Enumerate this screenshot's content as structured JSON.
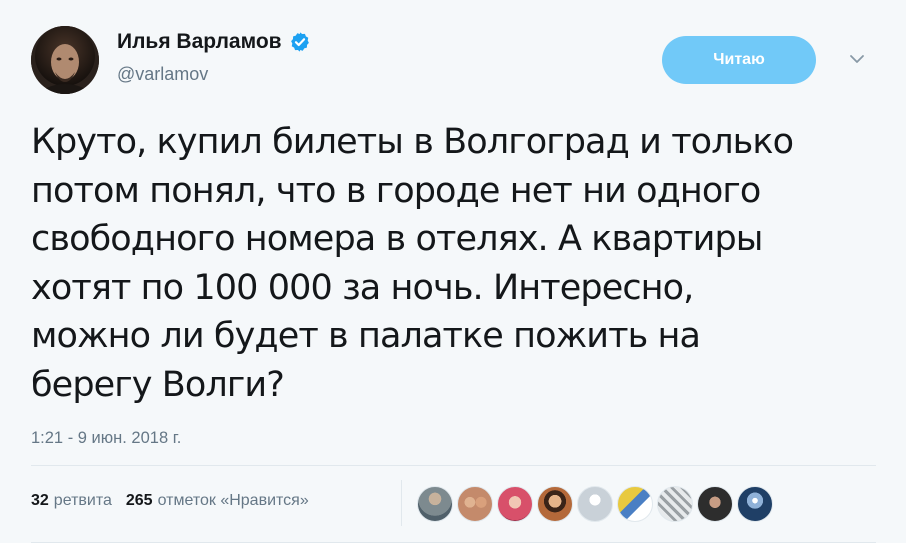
{
  "author": {
    "display_name": "Илья Варламов",
    "handle": "@varlamov",
    "verified_icon": "verified-badge-icon",
    "avatar_icon": "user-avatar"
  },
  "follow_button": {
    "label": "Читаю",
    "color": "#71c9f8"
  },
  "menu_caret_icon": "chevron-down-icon",
  "tweet": {
    "text": "Круто, купил билеты в Волгоград и только\nпотом понял, что в городе нет ни одного\nсвободного номера в отелях. А квартиры\nхотят по 100 000 за ночь. Интересно,\nможно ли будет в палатке пожить на\nберегу Волги?",
    "timestamp": "1:21 - 9 июн. 2018 г."
  },
  "stats": {
    "retweets_count": "32",
    "retweets_label": "ретвита",
    "likes_count": "265",
    "likes_label": "отметок «Нравится»"
  },
  "likers": [
    {
      "name": "liker-avatar-1",
      "color": "#7d8a8f"
    },
    {
      "name": "liker-avatar-2",
      "color": "#c48a6b"
    },
    {
      "name": "liker-avatar-3",
      "color": "#d8506a"
    },
    {
      "name": "liker-avatar-4",
      "color": "#b4693a"
    },
    {
      "name": "liker-avatar-5",
      "color": "#c9d1d8"
    },
    {
      "name": "liker-avatar-6",
      "color": "#e8c93f"
    },
    {
      "name": "liker-avatar-7",
      "color": "#9aa0a4"
    },
    {
      "name": "liker-avatar-8",
      "color": "#2d2d2d"
    },
    {
      "name": "liker-avatar-9",
      "color": "#1f3f66"
    }
  ],
  "colors": {
    "background": "#f5f8fa",
    "text": "#14171a",
    "secondary_text": "#657786",
    "verified_blue": "#1da1f2"
  }
}
